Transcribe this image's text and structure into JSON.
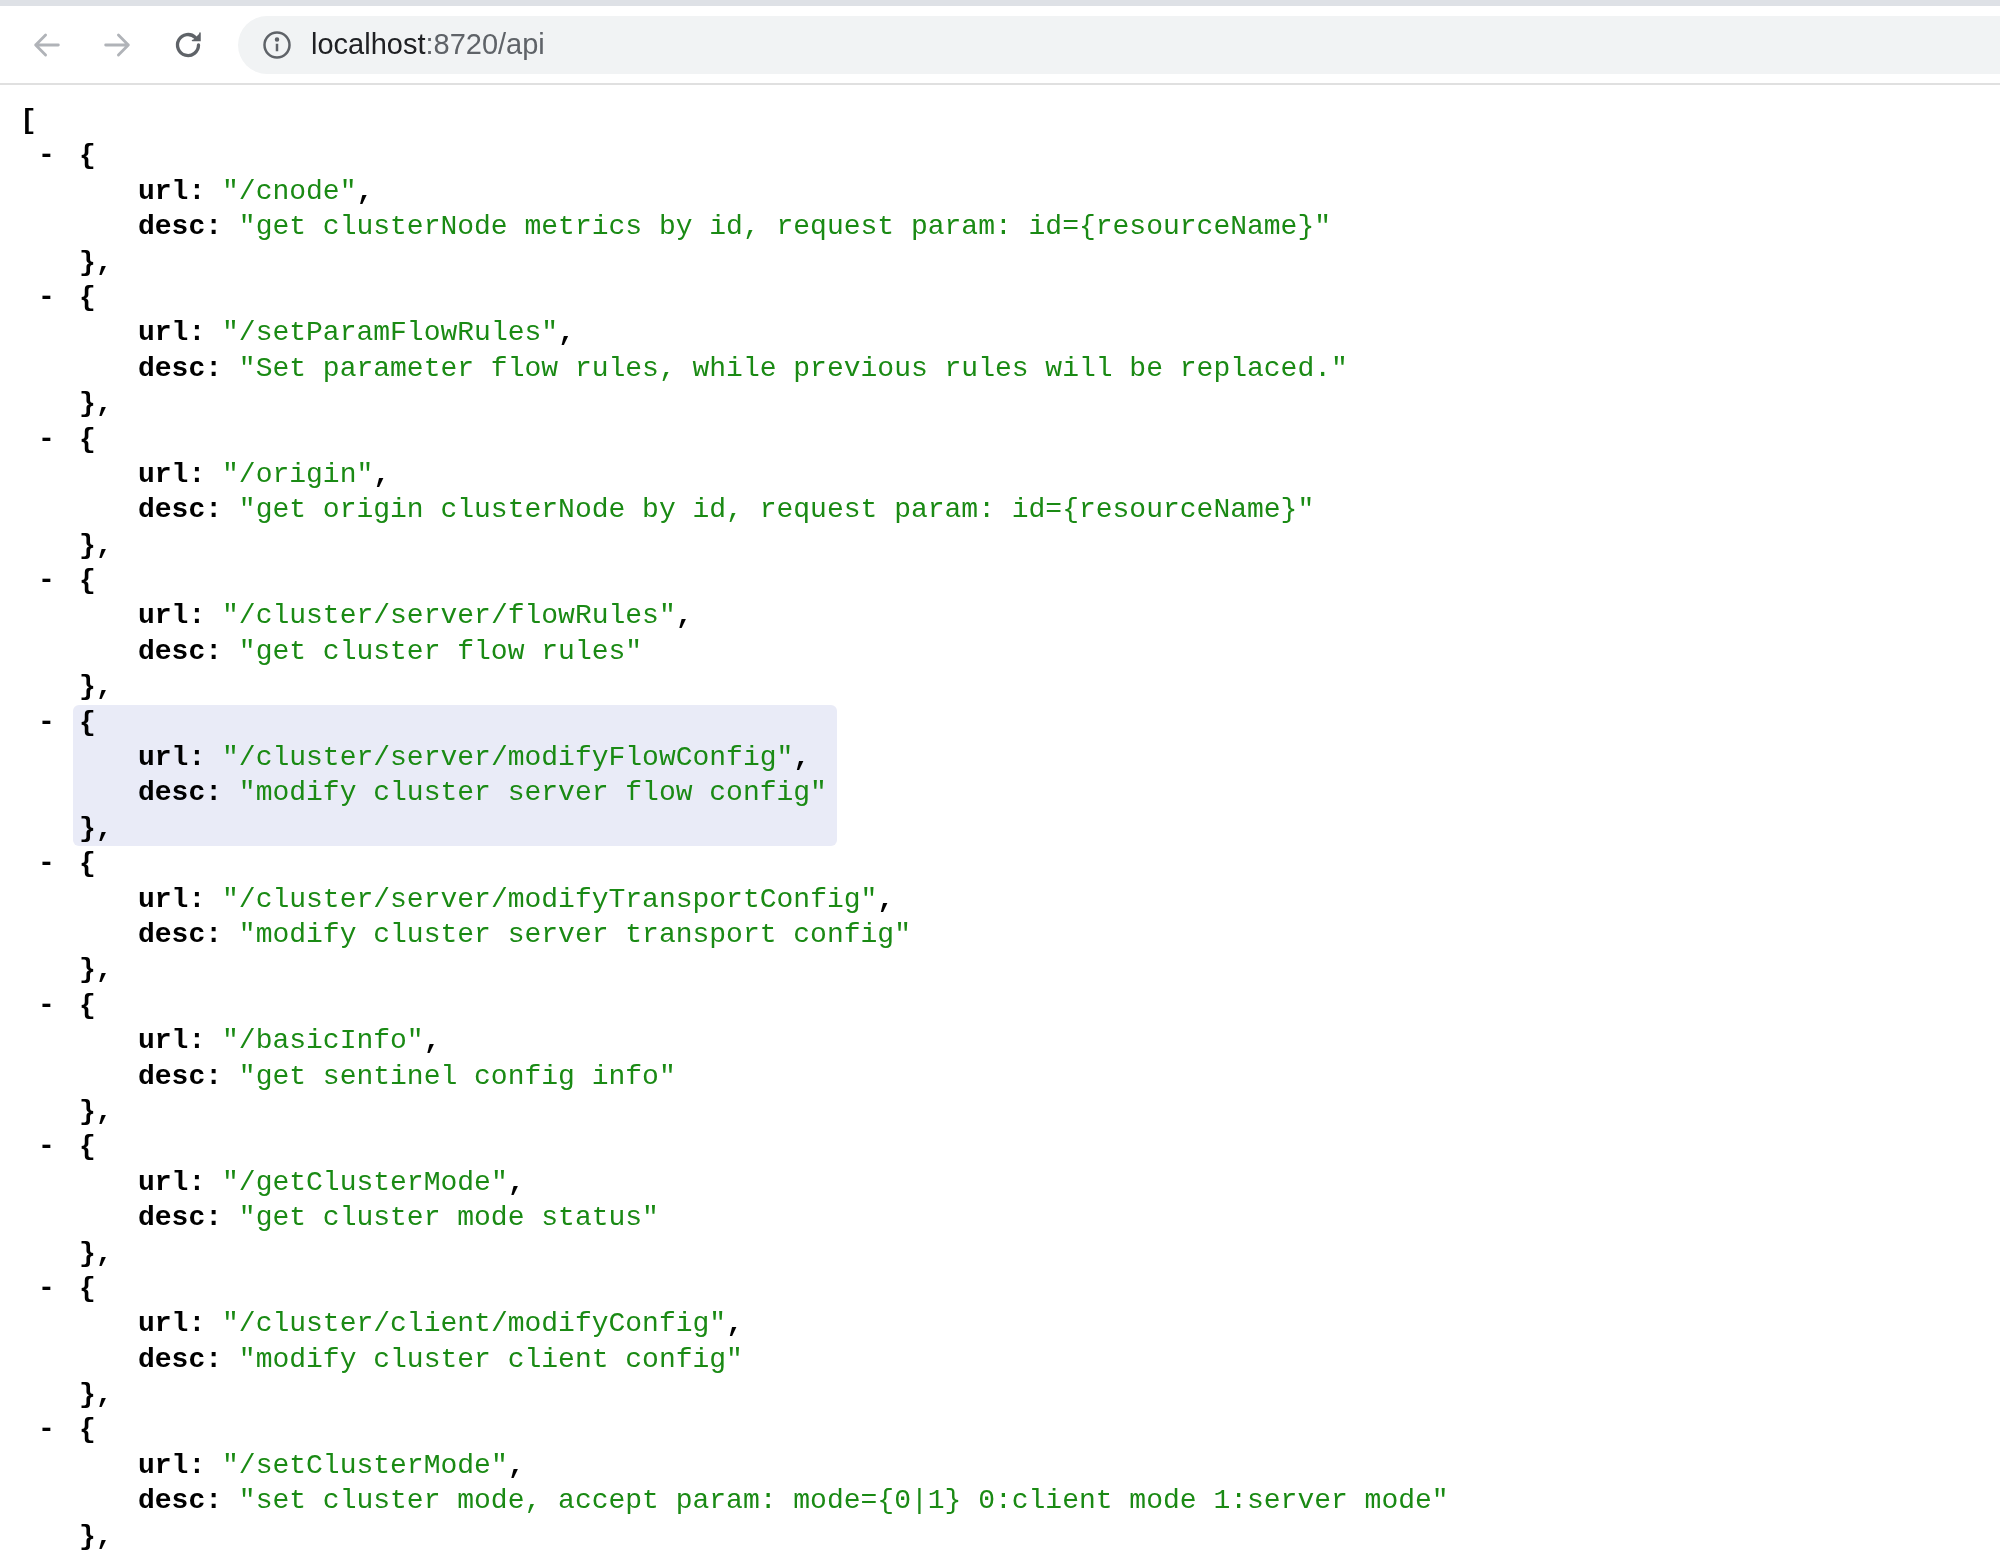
{
  "address_bar": {
    "host": "localhost",
    "path": ":8720/api"
  },
  "open_bracket": "[",
  "items": [
    {
      "toggle": "-",
      "open": "{",
      "fields": [
        {
          "key": "url:",
          "value": "\"/cnode\"",
          "sep": ","
        },
        {
          "key": "desc:",
          "value": "\"get clusterNode metrics by id, request param: id={resourceName}\""
        }
      ],
      "close": "},",
      "highlighted": false
    },
    {
      "toggle": "-",
      "open": "{",
      "fields": [
        {
          "key": "url:",
          "value": "\"/setParamFlowRules\"",
          "sep": ","
        },
        {
          "key": "desc:",
          "value": "\"Set parameter flow rules, while previous rules will be replaced.\""
        }
      ],
      "close": "},",
      "highlighted": false
    },
    {
      "toggle": "-",
      "open": "{",
      "fields": [
        {
          "key": "url:",
          "value": "\"/origin\"",
          "sep": ","
        },
        {
          "key": "desc:",
          "value": "\"get origin clusterNode by id, request param: id={resourceName}\""
        }
      ],
      "close": "},",
      "highlighted": false
    },
    {
      "toggle": "-",
      "open": "{",
      "fields": [
        {
          "key": "url:",
          "value": "\"/cluster/server/flowRules\"",
          "sep": ","
        },
        {
          "key": "desc:",
          "value": "\"get cluster flow rules\""
        }
      ],
      "close": "},",
      "highlighted": false
    },
    {
      "toggle": "-",
      "open": "{",
      "fields": [
        {
          "key": "url:",
          "value": "\"/cluster/server/modifyFlowConfig\"",
          "sep": ","
        },
        {
          "key": "desc:",
          "value": "\"modify cluster server flow config\""
        }
      ],
      "close": "},",
      "highlighted": true
    },
    {
      "toggle": "-",
      "open": "{",
      "fields": [
        {
          "key": "url:",
          "value": "\"/cluster/server/modifyTransportConfig\"",
          "sep": ","
        },
        {
          "key": "desc:",
          "value": "\"modify cluster server transport config\""
        }
      ],
      "close": "},",
      "highlighted": false
    },
    {
      "toggle": "-",
      "open": "{",
      "fields": [
        {
          "key": "url:",
          "value": "\"/basicInfo\"",
          "sep": ","
        },
        {
          "key": "desc:",
          "value": "\"get sentinel config info\""
        }
      ],
      "close": "},",
      "highlighted": false
    },
    {
      "toggle": "-",
      "open": "{",
      "fields": [
        {
          "key": "url:",
          "value": "\"/getClusterMode\"",
          "sep": ","
        },
        {
          "key": "desc:",
          "value": "\"get cluster mode status\""
        }
      ],
      "close": "},",
      "highlighted": false
    },
    {
      "toggle": "-",
      "open": "{",
      "fields": [
        {
          "key": "url:",
          "value": "\"/cluster/client/modifyConfig\"",
          "sep": ","
        },
        {
          "key": "desc:",
          "value": "\"modify cluster client config\""
        }
      ],
      "close": "},",
      "highlighted": false
    },
    {
      "toggle": "-",
      "open": "{",
      "fields": [
        {
          "key": "url:",
          "value": "\"/setClusterMode\"",
          "sep": ","
        },
        {
          "key": "desc:",
          "value": "\"set cluster mode, accept param: mode={0|1} 0:client mode 1:server mode\""
        }
      ],
      "close": "},",
      "highlighted": false
    }
  ]
}
